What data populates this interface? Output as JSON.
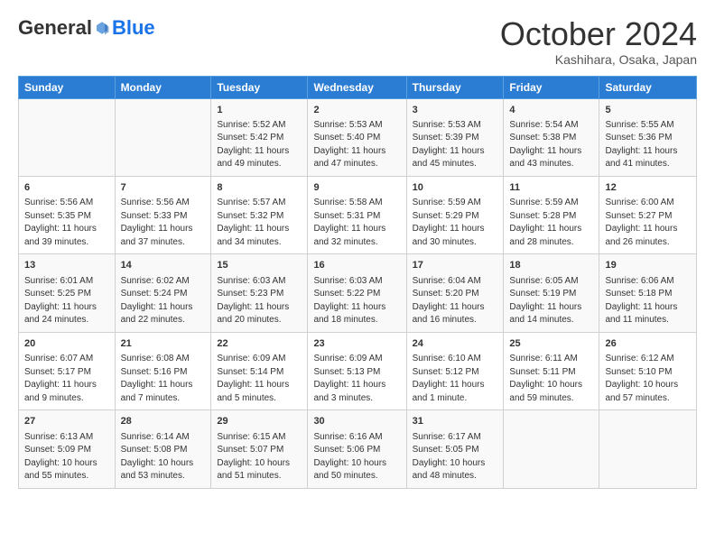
{
  "header": {
    "logo_general": "General",
    "logo_blue": "Blue",
    "month_year": "October 2024",
    "location": "Kashihara, Osaka, Japan"
  },
  "days_of_week": [
    "Sunday",
    "Monday",
    "Tuesday",
    "Wednesday",
    "Thursday",
    "Friday",
    "Saturday"
  ],
  "weeks": [
    [
      {
        "day": "",
        "content": ""
      },
      {
        "day": "",
        "content": ""
      },
      {
        "day": "1",
        "content": "Sunrise: 5:52 AM\nSunset: 5:42 PM\nDaylight: 11 hours and 49 minutes."
      },
      {
        "day": "2",
        "content": "Sunrise: 5:53 AM\nSunset: 5:40 PM\nDaylight: 11 hours and 47 minutes."
      },
      {
        "day": "3",
        "content": "Sunrise: 5:53 AM\nSunset: 5:39 PM\nDaylight: 11 hours and 45 minutes."
      },
      {
        "day": "4",
        "content": "Sunrise: 5:54 AM\nSunset: 5:38 PM\nDaylight: 11 hours and 43 minutes."
      },
      {
        "day": "5",
        "content": "Sunrise: 5:55 AM\nSunset: 5:36 PM\nDaylight: 11 hours and 41 minutes."
      }
    ],
    [
      {
        "day": "6",
        "content": "Sunrise: 5:56 AM\nSunset: 5:35 PM\nDaylight: 11 hours and 39 minutes."
      },
      {
        "day": "7",
        "content": "Sunrise: 5:56 AM\nSunset: 5:33 PM\nDaylight: 11 hours and 37 minutes."
      },
      {
        "day": "8",
        "content": "Sunrise: 5:57 AM\nSunset: 5:32 PM\nDaylight: 11 hours and 34 minutes."
      },
      {
        "day": "9",
        "content": "Sunrise: 5:58 AM\nSunset: 5:31 PM\nDaylight: 11 hours and 32 minutes."
      },
      {
        "day": "10",
        "content": "Sunrise: 5:59 AM\nSunset: 5:29 PM\nDaylight: 11 hours and 30 minutes."
      },
      {
        "day": "11",
        "content": "Sunrise: 5:59 AM\nSunset: 5:28 PM\nDaylight: 11 hours and 28 minutes."
      },
      {
        "day": "12",
        "content": "Sunrise: 6:00 AM\nSunset: 5:27 PM\nDaylight: 11 hours and 26 minutes."
      }
    ],
    [
      {
        "day": "13",
        "content": "Sunrise: 6:01 AM\nSunset: 5:25 PM\nDaylight: 11 hours and 24 minutes."
      },
      {
        "day": "14",
        "content": "Sunrise: 6:02 AM\nSunset: 5:24 PM\nDaylight: 11 hours and 22 minutes."
      },
      {
        "day": "15",
        "content": "Sunrise: 6:03 AM\nSunset: 5:23 PM\nDaylight: 11 hours and 20 minutes."
      },
      {
        "day": "16",
        "content": "Sunrise: 6:03 AM\nSunset: 5:22 PM\nDaylight: 11 hours and 18 minutes."
      },
      {
        "day": "17",
        "content": "Sunrise: 6:04 AM\nSunset: 5:20 PM\nDaylight: 11 hours and 16 minutes."
      },
      {
        "day": "18",
        "content": "Sunrise: 6:05 AM\nSunset: 5:19 PM\nDaylight: 11 hours and 14 minutes."
      },
      {
        "day": "19",
        "content": "Sunrise: 6:06 AM\nSunset: 5:18 PM\nDaylight: 11 hours and 11 minutes."
      }
    ],
    [
      {
        "day": "20",
        "content": "Sunrise: 6:07 AM\nSunset: 5:17 PM\nDaylight: 11 hours and 9 minutes."
      },
      {
        "day": "21",
        "content": "Sunrise: 6:08 AM\nSunset: 5:16 PM\nDaylight: 11 hours and 7 minutes."
      },
      {
        "day": "22",
        "content": "Sunrise: 6:09 AM\nSunset: 5:14 PM\nDaylight: 11 hours and 5 minutes."
      },
      {
        "day": "23",
        "content": "Sunrise: 6:09 AM\nSunset: 5:13 PM\nDaylight: 11 hours and 3 minutes."
      },
      {
        "day": "24",
        "content": "Sunrise: 6:10 AM\nSunset: 5:12 PM\nDaylight: 11 hours and 1 minute."
      },
      {
        "day": "25",
        "content": "Sunrise: 6:11 AM\nSunset: 5:11 PM\nDaylight: 10 hours and 59 minutes."
      },
      {
        "day": "26",
        "content": "Sunrise: 6:12 AM\nSunset: 5:10 PM\nDaylight: 10 hours and 57 minutes."
      }
    ],
    [
      {
        "day": "27",
        "content": "Sunrise: 6:13 AM\nSunset: 5:09 PM\nDaylight: 10 hours and 55 minutes."
      },
      {
        "day": "28",
        "content": "Sunrise: 6:14 AM\nSunset: 5:08 PM\nDaylight: 10 hours and 53 minutes."
      },
      {
        "day": "29",
        "content": "Sunrise: 6:15 AM\nSunset: 5:07 PM\nDaylight: 10 hours and 51 minutes."
      },
      {
        "day": "30",
        "content": "Sunrise: 6:16 AM\nSunset: 5:06 PM\nDaylight: 10 hours and 50 minutes."
      },
      {
        "day": "31",
        "content": "Sunrise: 6:17 AM\nSunset: 5:05 PM\nDaylight: 10 hours and 48 minutes."
      },
      {
        "day": "",
        "content": ""
      },
      {
        "day": "",
        "content": ""
      }
    ]
  ]
}
